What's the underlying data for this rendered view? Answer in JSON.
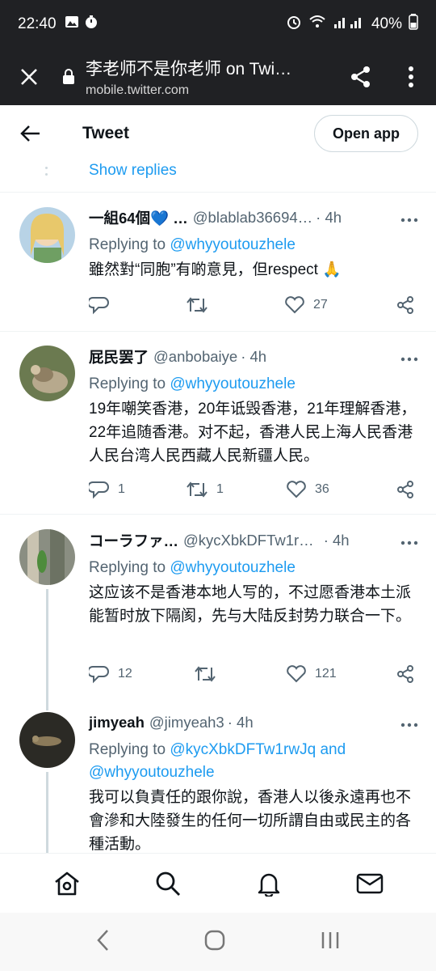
{
  "status_bar": {
    "time": "22:40",
    "battery": "40%"
  },
  "browser": {
    "page_title": "李老师不是你老师 on Twi…",
    "url": "mobile.twitter.com"
  },
  "header": {
    "title": "Tweet",
    "open_app_label": "Open app"
  },
  "show_replies_label": "Show replies",
  "tweets": [
    {
      "name": "一組64個💙 …",
      "handle": "@blablab36694…",
      "time": "· 4h",
      "replying_prefix": "Replying to",
      "replying_to": "@whyyoutouzhele",
      "text": "雖然對“同胞”有啲意見，但respect 🙏",
      "replies": "",
      "retweets": "",
      "likes": "27"
    },
    {
      "name": "屁民罢了",
      "handle": "@anbobaiye",
      "time": "· 4h",
      "replying_prefix": "Replying to",
      "replying_to": "@whyyoutouzhele",
      "text": "19年嘲笑香港，20年诋毁香港，21年理解香港，22年追随香港。对不起，香港人民上海人民香港人民台湾人民西藏人民新疆人民。",
      "replies": "1",
      "retweets": "1",
      "likes": "36"
    },
    {
      "name": "コーラファ…",
      "handle": "@kycXbkDFTw1r…",
      "time": "· 4h",
      "replying_prefix": "Replying to",
      "replying_to": "@whyyoutouzhele",
      "text": "这应该不是香港本地人写的，不过愿香港本土派能暂时放下隔阂，先与大陆反封势力联合一下。",
      "replies": "12",
      "retweets": "",
      "likes": "121"
    },
    {
      "name": "jimyeah",
      "handle": "@jimyeah3",
      "time": "· 4h",
      "replying_prefix": "Replying to",
      "replying_to": "@kycXbkDFTw1rwJq",
      "replying_and": "and",
      "replying_to_2": "@whyyoutouzhele",
      "text": "我可以負責任的跟你說，香港人以後永遠再也不會滲和大陸發生的任何一切所謂自由或民主的各種活動。"
    }
  ],
  "icons": {
    "status": [
      "gallery-icon",
      "timer-icon",
      "alarm-icon",
      "wifi-icon",
      "signal-icon",
      "battery-icon"
    ],
    "nav": [
      "home-icon",
      "search-icon",
      "notifications-icon",
      "messages-icon"
    ],
    "android": [
      "android-back-icon",
      "android-home-icon",
      "android-recents-icon"
    ]
  },
  "colors": {
    "accent": "#1d9bf0",
    "muted": "#536471",
    "chrome": "#202124"
  }
}
